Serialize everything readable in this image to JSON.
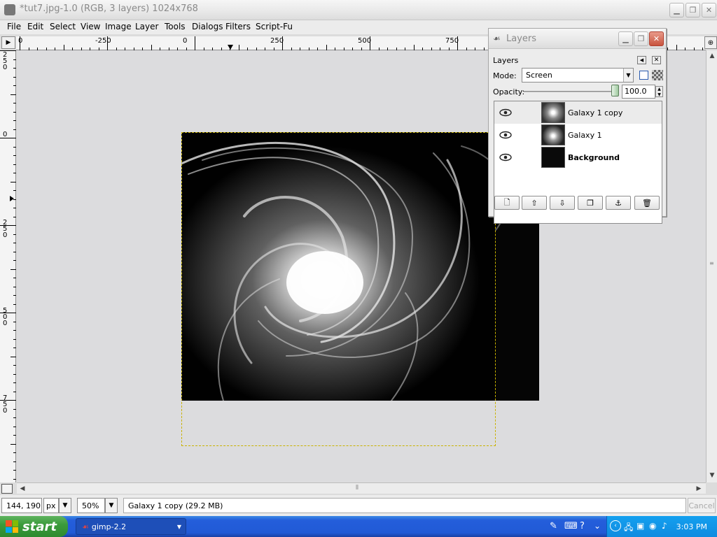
{
  "window": {
    "title": "*tut7.jpg-1.0 (RGB, 3 layers) 1024x768",
    "controls": [
      "minimize",
      "maximize",
      "close"
    ]
  },
  "menu": [
    {
      "label": "File"
    },
    {
      "label": "Edit"
    },
    {
      "label": "Select"
    },
    {
      "label": "View"
    },
    {
      "label": "Image"
    },
    {
      "label": "Layer"
    },
    {
      "label": "Tools"
    },
    {
      "label": "Dialogs"
    },
    {
      "label": "Filters"
    },
    {
      "label": "Script-Fu"
    }
  ],
  "rulers": {
    "horizontal_ticks": [
      "0",
      "-250",
      "0",
      "250",
      "500",
      "750"
    ],
    "vertical_ticks": [
      "250",
      "0",
      "250",
      "500",
      "750"
    ]
  },
  "layers_dialog": {
    "window_title": "Layers",
    "panel_title": "Layers",
    "mode_label": "Mode:",
    "mode_value": "Screen",
    "opacity_label": "Opacity:",
    "opacity_value": "100.0",
    "opacity_fraction": 1.0,
    "layers": [
      {
        "name": "Galaxy 1 copy",
        "visible": true,
        "selected": true,
        "bold": false
      },
      {
        "name": "Galaxy 1",
        "visible": true,
        "selected": false,
        "bold": false
      },
      {
        "name": "Background",
        "visible": true,
        "selected": false,
        "bold": true
      }
    ],
    "buttons": [
      "new-layer-icon",
      "raise-layer-icon",
      "lower-layer-icon",
      "duplicate-layer-icon",
      "anchor-layer-icon",
      "delete-layer-icon"
    ]
  },
  "statusbar": {
    "coords": "144, 190",
    "unit": "px",
    "zoom": "50%",
    "message": "Galaxy 1 copy (29.2 MB)",
    "cancel": "Cancel"
  },
  "taskbar": {
    "start": "start",
    "task_label": "gimp-2.2",
    "clock": "3:03 PM"
  },
  "colors": {
    "selection_outline": "#c9b200",
    "canvas_bg": "#dcdcde",
    "taskbar": "#245edb",
    "start_button": "#3b9b3b"
  }
}
